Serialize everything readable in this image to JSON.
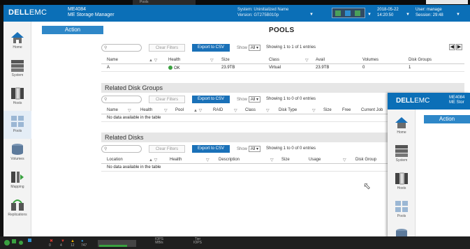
{
  "top_strip": {
    "tab_label": "Pools"
  },
  "header": {
    "brand_dell": "DELL",
    "brand_emc": "EMC",
    "product_model": "ME4084",
    "product_name": "ME Storage Manager",
    "system_line": "System: Uninitialized Name",
    "version_line": "Version: GT275B010p",
    "date": "2018-05-22",
    "time": "14:20:50",
    "user_line": "User: manage",
    "session_line": "Session: 29:48"
  },
  "sidebar": {
    "items": [
      {
        "label": "Home",
        "icon": "home-icon"
      },
      {
        "label": "System",
        "icon": "system-icon"
      },
      {
        "label": "Hosts",
        "icon": "hosts-icon"
      },
      {
        "label": "Pools",
        "icon": "pools-icon"
      },
      {
        "label": "Volumes",
        "icon": "volumes-icon"
      },
      {
        "label": "Mapping",
        "icon": "mapping-icon"
      },
      {
        "label": "Replications",
        "icon": "replications-icon"
      }
    ]
  },
  "main": {
    "action_label": "Action",
    "page_title": "POOLS",
    "pools_toolbar": {
      "clear_filters": "Clear Filters",
      "export_csv": "Export to CSV",
      "show_label": "Show",
      "show_value": "All",
      "showing": "Showing 1 to 1 of 1 entries",
      "pager_prev": "◀",
      "pager_next": "▶"
    },
    "pools_table": {
      "columns": [
        "Name",
        "Health",
        "Size",
        "Class",
        "Avail",
        "Volumes",
        "Disk Groups"
      ],
      "rows": [
        {
          "name": "A",
          "health": "OK",
          "size": "23.9TB",
          "class": "Virtual",
          "avail": "23.9TB",
          "volumes": "0",
          "disk_groups": "1"
        }
      ]
    },
    "disk_groups_title": "Related Disk Groups",
    "dg_toolbar": {
      "clear_filters": "Clear Filters",
      "export_csv": "Export to CSV",
      "show_label": "Show",
      "show_value": "All",
      "showing": "Showing 1 to 0 of 0 entries"
    },
    "dg_table": {
      "columns": [
        "Name",
        "Health",
        "Pool",
        "RAID",
        "Class",
        "Disk Type",
        "Size",
        "Free",
        "Current Job"
      ],
      "empty": "No data available in the table"
    },
    "disks_title": "Related Disks",
    "disks_toolbar": {
      "clear_filters": "Clear Filters",
      "export_csv": "Export to CSV",
      "show_label": "Show",
      "show_value": "All",
      "showing": "Showing 1 to 0 of 0 entries"
    },
    "disks_table": {
      "columns": [
        "Location",
        "Health",
        "Description",
        "Size",
        "Usage",
        "Disk Group"
      ],
      "empty": "No data available in the table"
    }
  },
  "overlay": {
    "brand_dell": "DELL",
    "brand_emc": "EMC",
    "product_model": "ME4084",
    "product_name": "ME Stor",
    "action_label": "Action",
    "sidebar": [
      "Home",
      "System",
      "Hosts",
      "Pools"
    ]
  },
  "statusbar": {
    "counts": [
      "0",
      "4",
      "12",
      "747"
    ],
    "iops_label": "IOPS",
    "mbs_label": "MB/s",
    "iops2_label": "IOPS",
    "tier_label": "Tier"
  },
  "colors": {
    "brand_blue": "#0b6fb7",
    "action_blue": "#2e87c8",
    "ok_green": "#3aa140"
  }
}
